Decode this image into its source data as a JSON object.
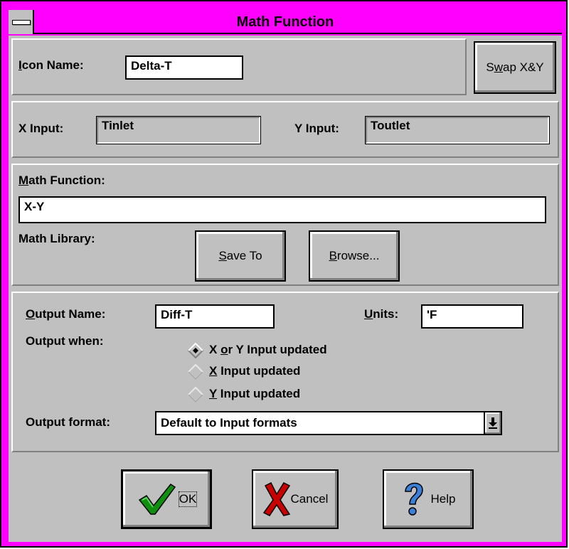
{
  "window": {
    "title": "Math Function",
    "titlebar_color": "#ff00ff",
    "face_color": "#c0c0c0"
  },
  "icon_name": {
    "label_prefix": "I",
    "label_rest": "con Name:",
    "value": "Delta-T"
  },
  "swap_button": {
    "label_pre": "S",
    "label_mnemonic": "w",
    "label_post": "ap X&Y"
  },
  "inputs": {
    "x_label": "X Input:",
    "x_value": "Tinlet",
    "y_label": "Y Input:",
    "y_value": "Toutlet"
  },
  "math": {
    "function_label_mnemonic": "M",
    "function_label_rest": "ath Function:",
    "function_value": "X-Y",
    "library_label": "Math Library:",
    "save_to_mnemonic": "S",
    "save_to_rest": "ave To",
    "browse_mnemonic": "B",
    "browse_rest": "rowse..."
  },
  "output": {
    "name_label_mnemonic": "O",
    "name_label_rest": "utput Name:",
    "name_value": "Diff-T",
    "units_label_mnemonic": "U",
    "units_label_rest": "nits:",
    "units_value": "'F",
    "when_label": "Output when:",
    "options": [
      {
        "pre": "X ",
        "mnemonic": "o",
        "mid": "r",
        "post": " Y Input updated",
        "selected": true
      },
      {
        "pre": "",
        "mnemonic": "X",
        "mid": "",
        "post": " Input updated",
        "selected": false
      },
      {
        "pre": "",
        "mnemonic": "Y",
        "mid": "",
        "post": " Input updated",
        "selected": false
      }
    ],
    "format_label": "Output format:",
    "format_value": "Default to Input formats"
  },
  "buttons": {
    "ok": "OK",
    "cancel": "Cancel",
    "help": "Help",
    "ok_icon": "checkmark-icon",
    "cancel_icon": "x-cross-icon",
    "help_icon": "question-mark-icon"
  }
}
